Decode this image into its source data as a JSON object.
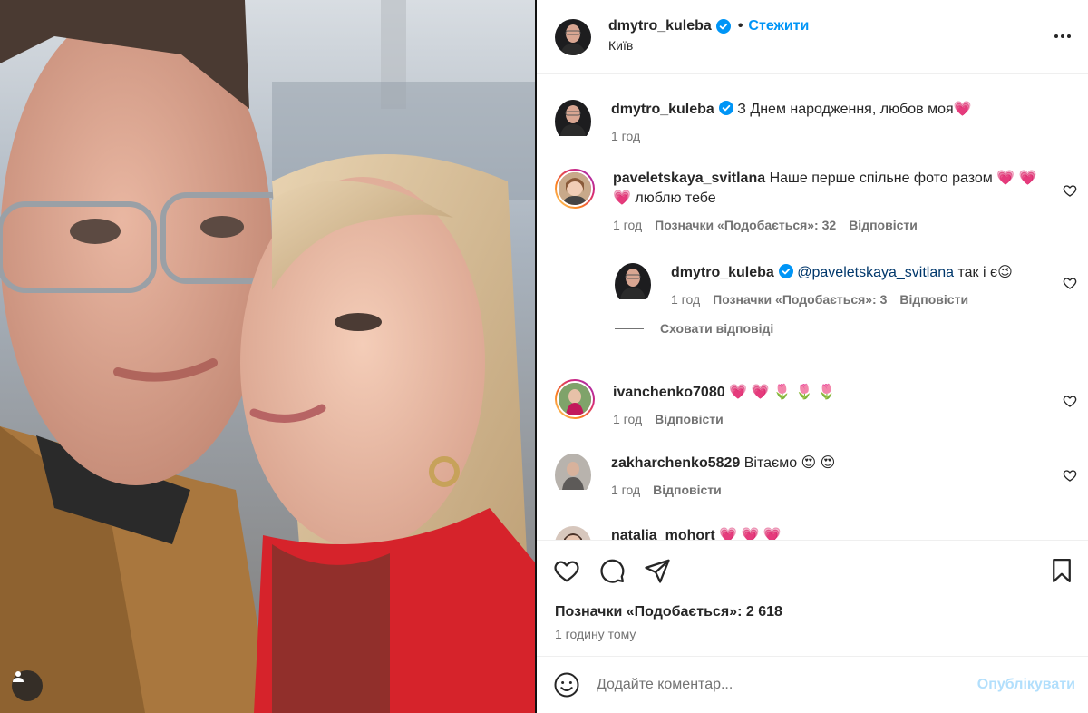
{
  "header": {
    "username": "dmytro_kuleba",
    "separator": "•",
    "follow_label": "Стежити",
    "location": "Київ",
    "more_icon": "more-options-icon"
  },
  "caption": {
    "username": "dmytro_kuleba",
    "text": " З Днем народження, любов моя💗",
    "time": "1 год"
  },
  "comments": [
    {
      "username": "paveletskaya_svitlana",
      "text": " Наше перше спільне фото разом 💗 💗 💗 люблю тебе",
      "time": "1 год",
      "likes": "Позначки «Подобається»: 32",
      "reply": "Відповісти"
    },
    {
      "username": "dmytro_kuleba",
      "mention": "@paveletskaya_svitlana",
      "text": " так і є😉",
      "time": "1 год",
      "likes": "Позначки «Подобається»: 3",
      "reply": "Відповісти"
    },
    {
      "username": "ivanchenko7080",
      "text": " 💗 💗 🌷 🌷 🌷",
      "time": "1 год",
      "reply": "Відповісти"
    },
    {
      "username": "zakharchenko5829",
      "text": " Вітаємо 😍 😍",
      "time": "1 год",
      "reply": "Відповісти"
    },
    {
      "username": "natalia_mohort",
      "text": " 💗 💗 💗"
    }
  ],
  "hide_replies": "Сховати відповіді",
  "actions": {
    "likes": "Позначки «Подобається»: 2 618",
    "time": "1 годину тому"
  },
  "add_comment": {
    "placeholder": "Додайте коментар...",
    "publish": "Опублікувати"
  },
  "colors": {
    "accent": "#0095f6",
    "publish_disabled": "#b2dffc",
    "secondary_text": "#737373"
  }
}
